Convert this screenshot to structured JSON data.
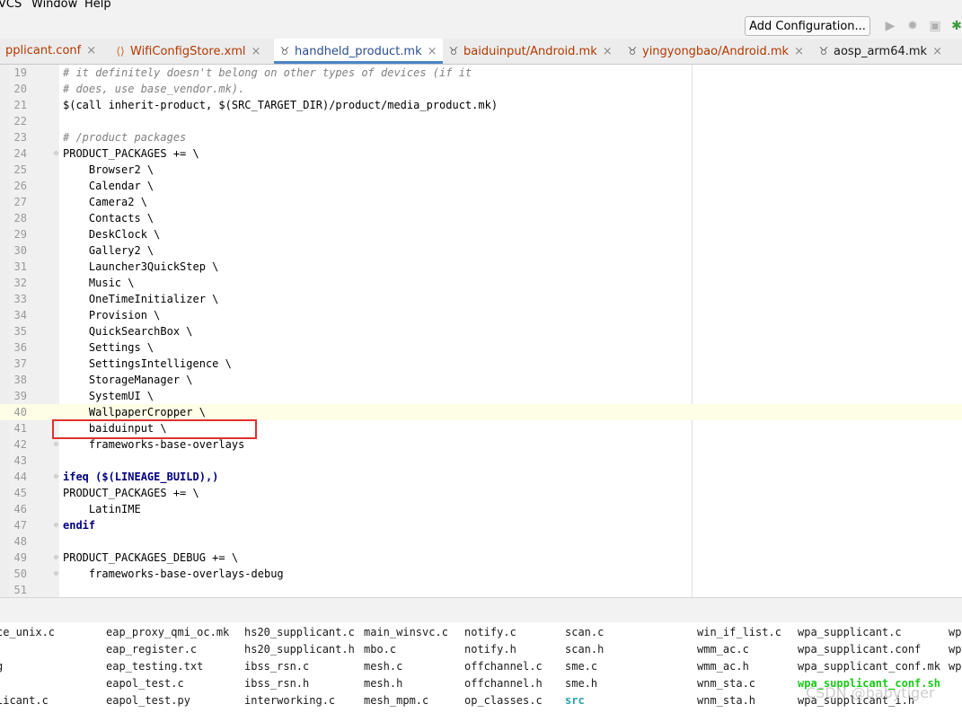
{
  "menubar": {
    "vcs": "VCS",
    "window": "Window",
    "help": "Help"
  },
  "toolbar": {
    "add_configuration": "Add Configuration..."
  },
  "tabs": [
    {
      "label": "pplicant.conf"
    },
    {
      "label": "WifiConfigStore.xml"
    },
    {
      "label": "handheld_product.mk",
      "active": true
    },
    {
      "label": "baiduinput/Android.mk"
    },
    {
      "label": "yingyongbao/Android.mk"
    },
    {
      "label": "aosp_arm64.mk"
    }
  ],
  "editor": {
    "current_line": "40",
    "highlighted_line": "41",
    "lines": [
      {
        "num": "19",
        "text": "# it definitely doesn't belong on other types of devices (if it"
      },
      {
        "num": "20",
        "text": "# does, use base_vendor.mk)."
      },
      {
        "num": "21",
        "text": "$(call inherit-product, $(SRC_TARGET_DIR)/product/media_product.mk)"
      },
      {
        "num": "22",
        "text": ""
      },
      {
        "num": "23",
        "text": "# /product packages"
      },
      {
        "num": "24",
        "text": "PRODUCT_PACKAGES += \\"
      },
      {
        "num": "25",
        "text": "    Browser2 \\"
      },
      {
        "num": "26",
        "text": "    Calendar \\"
      },
      {
        "num": "27",
        "text": "    Camera2 \\"
      },
      {
        "num": "28",
        "text": "    Contacts \\"
      },
      {
        "num": "29",
        "text": "    DeskClock \\"
      },
      {
        "num": "30",
        "text": "    Gallery2 \\"
      },
      {
        "num": "31",
        "text": "    Launcher3QuickStep \\"
      },
      {
        "num": "32",
        "text": "    Music \\"
      },
      {
        "num": "33",
        "text": "    OneTimeInitializer \\"
      },
      {
        "num": "34",
        "text": "    Provision \\"
      },
      {
        "num": "35",
        "text": "    QuickSearchBox \\"
      },
      {
        "num": "36",
        "text": "    Settings \\"
      },
      {
        "num": "37",
        "text": "    SettingsIntelligence \\"
      },
      {
        "num": "38",
        "text": "    StorageManager \\"
      },
      {
        "num": "39",
        "text": "    SystemUI \\"
      },
      {
        "num": "40",
        "text": "    WallpaperCropper \\"
      },
      {
        "num": "41",
        "text": "    baiduinput \\"
      },
      {
        "num": "42",
        "text": "    frameworks-base-overlays"
      },
      {
        "num": "43",
        "text": ""
      },
      {
        "num": "44",
        "text": "ifeq ($(LINEAGE_BUILD),)"
      },
      {
        "num": "45",
        "text": "PRODUCT_PACKAGES += \\"
      },
      {
        "num": "46",
        "text": "    LatinIME"
      },
      {
        "num": "47",
        "text": "endif"
      },
      {
        "num": "48",
        "text": ""
      },
      {
        "num": "49",
        "text": "PRODUCT_PACKAGES_DEBUG += \\"
      },
      {
        "num": "50",
        "text": "    frameworks-base-overlays-debug"
      },
      {
        "num": "51",
        "text": ""
      }
    ]
  },
  "terminal": {
    "columns": [
      [
        "ce_unix.c",
        "",
        "g",
        "",
        "licant.c"
      ],
      [
        "eap_proxy_qmi_oc.mk",
        "eap_register.c",
        "eap_testing.txt",
        "eapol_test.c",
        "eapol_test.py"
      ],
      [
        "hs20_supplicant.c",
        "hs20_supplicant.h",
        "ibss_rsn.c",
        "ibss_rsn.h",
        "interworking.c"
      ],
      [
        "main_winsvc.c",
        "mbo.c",
        "mesh.c",
        "mesh.h",
        "mesh_mpm.c"
      ],
      [
        "notify.c",
        "notify.h",
        "offchannel.c",
        "offchannel.h",
        "op_classes.c"
      ],
      [
        "scan.c",
        "scan.h",
        "sme.c",
        "sme.h",
        "src"
      ],
      [
        "win_if_list.c",
        "wmm_ac.c",
        "wmm_ac.h",
        "wnm_sta.c",
        "wnm_sta.h"
      ],
      [
        "wpa_supplicant.c",
        "wpa_supplicant.conf",
        "wpa_supplicant_conf.mk",
        "wpa_supplicant_conf.sh",
        "wpa_supplicant_i.h"
      ],
      [
        "wp",
        "wp",
        "wp",
        "",
        ""
      ]
    ]
  },
  "watermark": "CSDN @babytiger"
}
